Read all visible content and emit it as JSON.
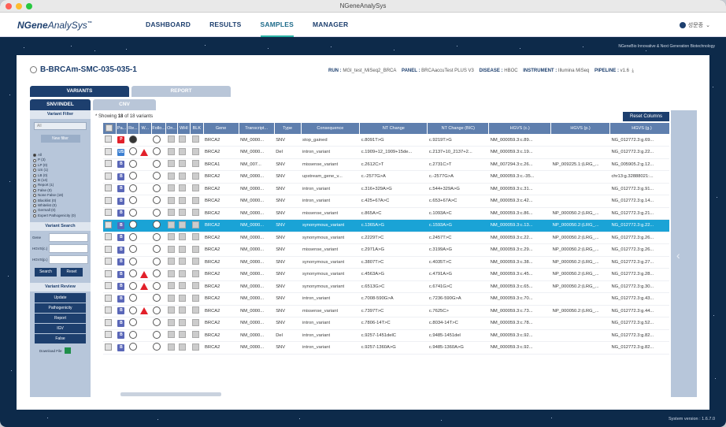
{
  "window": {
    "title": "NGeneAnalySys"
  },
  "nav": {
    "logo_main": "NGene",
    "logo_rest": "AnalySys",
    "logo_tm": "™",
    "items": [
      {
        "label": "DASHBOARD"
      },
      {
        "label": "RESULTS"
      },
      {
        "label": "SAMPLES"
      },
      {
        "label": "MANAGER"
      }
    ],
    "active": "SAMPLES",
    "user": "성문종"
  },
  "tagline": "NGeneBio   Innovative & Next Generation Biotechnology",
  "version": "System version : 1.6.7.0",
  "sample": {
    "id": "B-BRCAm-SMC-035-035-1",
    "run_label": "RUN :",
    "run": "MGI_test_MiSeq2_BRCA",
    "panel_label": "PANEL :",
    "panel": "BRCAaccuTest PLUS V3",
    "disease_label": "DISEASE :",
    "disease": "HBOC",
    "instrument_label": "INSTRUMENT :",
    "instrument": "Illumina MiSeq",
    "pipeline_label": "PIPELINE :",
    "pipeline": "v1.6"
  },
  "tabs": {
    "variants": "VARIANTS",
    "report": "REPORT",
    "snv": "SNV/INDEL",
    "cnv": "CNV"
  },
  "filter": {
    "title": "Variant Filter",
    "select": "All",
    "new_filter": "New filter",
    "radios": [
      "All",
      "P (3)",
      "LP (0)",
      "US (1)",
      "LB (0)",
      "B (14)",
      "Report (1)",
      "False (0)",
      "None False (18)",
      "Blacklist (0)",
      "Whitelist (0)",
      "Germall (0)",
      "Expert Pathogenicity (0)"
    ]
  },
  "search": {
    "title": "Variant Search",
    "gene": "Gene",
    "hgvsc": "HGVS(c.)",
    "hgvsp": "HGVS(p.)",
    "search_btn": "Search",
    "reset_btn": "Reset"
  },
  "review": {
    "title": "Variant Review",
    "buttons": [
      "Update",
      "Pathogenicity",
      "Report",
      "IGV",
      "False"
    ],
    "download": "Download File"
  },
  "table": {
    "showing_prefix": "Showing",
    "count": "18",
    "showing_suffix": "of 18 variants",
    "reset_columns": "Reset Columns",
    "headers": [
      "",
      "Pa...",
      "Re...",
      "W...",
      "Follo...",
      "On...",
      "WHI",
      "BLK",
      "Gene",
      "Transcript...",
      "Type",
      "Consequence",
      "NT Change",
      "NT Change (BIC)",
      "HGVS (c.)",
      "HGVS (p.)",
      "HGVS (g.)"
    ],
    "rows": [
      {
        "tier": "P",
        "tc": "#e2202a",
        "re": "filled",
        "warn": false,
        "gene": "BRCA2",
        "tx": "NM_0000...",
        "type": "SNV",
        "cons": "stop_gained",
        "nt": "c.8091T>G",
        "bic": "c.9219T>G",
        "c": "NM_000059.3:c.89...",
        "p": "",
        "g": "NG_012772.3:g.69..."
      },
      {
        "tier": "US",
        "tc": "#3b7fd1",
        "re": "",
        "warn": true,
        "gene": "BRCA2",
        "tx": "NM_0000...",
        "type": "Del",
        "cons": "intron_variant",
        "nt": "c.1909+12_1909+15de...",
        "bic": "c.2137+10_2137+2...",
        "c": "NM_000059.3:c.19...",
        "p": "",
        "g": "NG_012772.3:g.22..."
      },
      {
        "tier": "B",
        "tc": "#5a67b8",
        "re": "",
        "warn": false,
        "gene": "BRCA1",
        "tx": "NM_007...",
        "type": "SNV",
        "cons": "missense_variant",
        "nt": "c.2612C>T",
        "bic": "c.2731C>T",
        "c": "NM_007294.3:c.26...",
        "p": "NP_009225.1:(LRG_...",
        "g": "NG_005905.2:g.12..."
      },
      {
        "tier": "B",
        "tc": "#5a67b8",
        "re": "",
        "warn": false,
        "gene": "BRCA2",
        "tx": "NM_0000...",
        "type": "SNV",
        "cons": "upstream_gene_v...",
        "nt": "c.-2577G>A",
        "bic": "c.-2577G>A",
        "c": "NM_000059.3:c.-35...",
        "p": "",
        "g": "chr13:g.32888021:..."
      },
      {
        "tier": "B",
        "tc": "#5a67b8",
        "re": "",
        "warn": false,
        "gene": "BRCA2",
        "tx": "NM_0000...",
        "type": "SNV",
        "cons": "intron_variant",
        "nt": "c.316+329A>G",
        "bic": "c.544+329A>G",
        "c": "NM_000059.3:c.31...",
        "p": "",
        "g": "NG_012772.3:g.91..."
      },
      {
        "tier": "B",
        "tc": "#5a67b8",
        "re": "",
        "warn": false,
        "gene": "BRCA2",
        "tx": "NM_0000...",
        "type": "SNV",
        "cons": "intron_variant",
        "nt": "c.425+67A>C",
        "bic": "c.653+67A>C",
        "c": "NM_000059.3:c.42...",
        "p": "",
        "g": "NG_012772.3:g.14..."
      },
      {
        "tier": "B",
        "tc": "#5a67b8",
        "re": "",
        "warn": false,
        "gene": "BRCA2",
        "tx": "NM_0000...",
        "type": "SNV",
        "cons": "missense_variant",
        "nt": "c.865A>C",
        "bic": "c.1093A>C",
        "c": "NM_000059.3:c.86...",
        "p": "NP_000050.2:(LRG_...",
        "g": "NG_012772.3:g.21..."
      },
      {
        "tier": "B",
        "tc": "#5a67b8",
        "re": "",
        "warn": false,
        "sel": true,
        "gene": "BRCA2",
        "tx": "NM_0000...",
        "type": "SNV",
        "cons": "synonymous_variant",
        "nt": "c.1365A>G",
        "bic": "c.1593A>G",
        "c": "NM_000059.3:c.13...",
        "p": "NP_000050.2:(LRG_...",
        "g": "NG_012772.3:g.22..."
      },
      {
        "tier": "B",
        "tc": "#5a67b8",
        "re": "",
        "warn": false,
        "gene": "BRCA2",
        "tx": "NM_0000...",
        "type": "SNV",
        "cons": "synonymous_variant",
        "nt": "c.2229T>C",
        "bic": "c.2457T>C",
        "c": "NM_000059.3:c.22...",
        "p": "NP_000050.2:(LRG_...",
        "g": "NG_012772.3:g.26..."
      },
      {
        "tier": "B",
        "tc": "#5a67b8",
        "re": "",
        "warn": false,
        "gene": "BRCA2",
        "tx": "NM_0000...",
        "type": "SNV",
        "cons": "missense_variant",
        "nt": "c.2971A>G",
        "bic": "c.3199A>G",
        "c": "NM_000059.3:c.29...",
        "p": "NP_000050.2:(LRG_...",
        "g": "NG_012772.3:g.26..."
      },
      {
        "tier": "B",
        "tc": "#5a67b8",
        "re": "",
        "warn": false,
        "gene": "BRCA2",
        "tx": "NM_0000...",
        "type": "SNV",
        "cons": "synonymous_variant",
        "nt": "c.3807T>C",
        "bic": "c.4035T>C",
        "c": "NM_000059.3:c.38...",
        "p": "NP_000050.2:(LRG_...",
        "g": "NG_012772.3:g.27..."
      },
      {
        "tier": "B",
        "tc": "#5a67b8",
        "re": "",
        "warn": true,
        "gene": "BRCA2",
        "tx": "NM_0000...",
        "type": "SNV",
        "cons": "synonymous_variant",
        "nt": "c.4563A>G",
        "bic": "c.4791A>G",
        "c": "NM_000059.3:c.45...",
        "p": "NP_000050.2:(LRG_...",
        "g": "NG_012772.3:g.28..."
      },
      {
        "tier": "B",
        "tc": "#5a67b8",
        "re": "",
        "warn": true,
        "gene": "BRCA2",
        "tx": "NM_0000...",
        "type": "SNV",
        "cons": "synonymous_variant",
        "nt": "c.6513G>C",
        "bic": "c.6741G>C",
        "c": "NM_000059.3:c.65...",
        "p": "NP_000050.2:(LRG_...",
        "g": "NG_012772.3:g.30..."
      },
      {
        "tier": "B",
        "tc": "#5a67b8",
        "re": "",
        "warn": false,
        "gene": "BRCA2",
        "tx": "NM_0000...",
        "type": "SNV",
        "cons": "intron_variant",
        "nt": "c.7008-590G>A",
        "bic": "c.7236-590G>A",
        "c": "NM_000059.3:c.70...",
        "p": "",
        "g": "NG_012772.3:g.43..."
      },
      {
        "tier": "B",
        "tc": "#5a67b8",
        "re": "",
        "warn": true,
        "gene": "BRCA2",
        "tx": "NM_0000...",
        "type": "SNV",
        "cons": "missense_variant",
        "nt": "c.7397T>C",
        "bic": "c.7625C>",
        "c": "NM_000059.3:c.73...",
        "p": "NP_000050.2:(LRG_...",
        "g": "NG_012772.3:g.44..."
      },
      {
        "tier": "B",
        "tc": "#5a67b8",
        "re": "",
        "warn": false,
        "gene": "BRCA2",
        "tx": "NM_0000...",
        "type": "SNV",
        "cons": "intron_variant",
        "nt": "c.7806-14T>C",
        "bic": "c.8034-14T>C",
        "c": "NM_000059.3:c.78...",
        "p": "",
        "g": "NG_012772.3:g.52..."
      },
      {
        "tier": "B",
        "tc": "#5a67b8",
        "re": "",
        "warn": false,
        "gene": "BRCA2",
        "tx": "NM_0000...",
        "type": "Del",
        "cons": "intron_variant",
        "nt": "c.9257-1451delC",
        "bic": "c.9485-1451del",
        "c": "NM_000059.3:c.92...",
        "p": "",
        "g": "NG_012772.3:g.82..."
      },
      {
        "tier": "B",
        "tc": "#5a67b8",
        "re": "",
        "warn": false,
        "gene": "BRCA2",
        "tx": "NM_0000...",
        "type": "SNV",
        "cons": "intron_variant",
        "nt": "c.9257-1360A>G",
        "bic": "c.9485-1360A>G",
        "c": "NM_000059.3:c.92...",
        "p": "",
        "g": "NG_012772.3:g.82..."
      }
    ]
  }
}
